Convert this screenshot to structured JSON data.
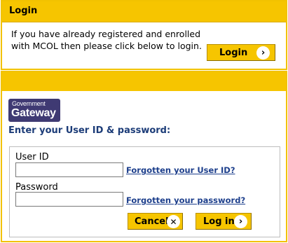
{
  "login": {
    "header": "Login",
    "message": "If you have already registered and enrolled with MCOL then please click below to login.",
    "button_label": "Login",
    "button_icon": "›"
  },
  "gateway": {
    "logo_top": "Government",
    "logo_bottom": "Gateway",
    "title": "Enter your User ID & password:",
    "user_id_label": "User ID",
    "user_id_value": "",
    "forgot_user_id": "Forgotten your User ID?",
    "password_label": "Password",
    "password_value": "",
    "forgot_password": "Forgotten your password?",
    "cancel_label": "Cancel",
    "cancel_icon": "✕",
    "login_label": "Log in",
    "login_icon": "›"
  },
  "colors": {
    "accent_yellow": "#f6c500",
    "link_blue": "#1d3f8c",
    "title_blue": "#1c3c78",
    "logo_purple": "#3f3a73"
  }
}
